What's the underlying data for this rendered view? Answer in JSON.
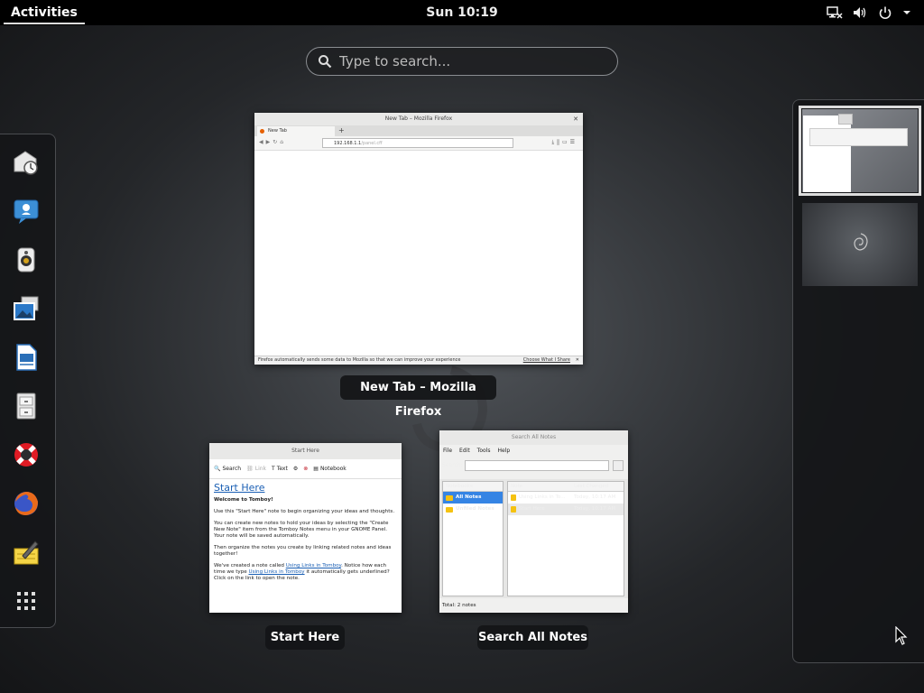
{
  "topbar": {
    "activities_label": "Activities",
    "clock": "Sun 10:19",
    "tray_icons": [
      "network-icon",
      "volume-icon",
      "power-icon",
      "chevron-down-icon"
    ]
  },
  "search": {
    "placeholder": "Type to search..."
  },
  "dash": {
    "items": [
      {
        "name": "evolution",
        "icon": "mail-clock-icon"
      },
      {
        "name": "empathy",
        "icon": "chat-bubble-icon"
      },
      {
        "name": "rhythmbox",
        "icon": "speaker-icon"
      },
      {
        "name": "shotwell",
        "icon": "photos-icon"
      },
      {
        "name": "libreoffice-writer",
        "icon": "document-icon"
      },
      {
        "name": "files",
        "icon": "file-cabinet-icon"
      },
      {
        "name": "help",
        "icon": "lifebuoy-icon"
      },
      {
        "name": "firefox",
        "icon": "firefox-icon"
      },
      {
        "name": "tomboy",
        "icon": "notes-pen-icon"
      },
      {
        "name": "show-applications",
        "icon": "app-grid-icon"
      }
    ]
  },
  "windows": {
    "firefox": {
      "caption": "New Tab – Mozilla Firefox",
      "title": "New Tab – Mozilla Firefox",
      "tab_label": "New Tab",
      "url_typed": "192.168.1.1",
      "url_suggest": "/panel.cff",
      "status_text": "Firefox automatically sends some data to Mozilla so that we can improve your experience",
      "status_link": "Choose What I Share"
    },
    "start_here": {
      "caption": "Start Here",
      "title": "Start Here",
      "toolbar": {
        "search": "Search",
        "link": "Link",
        "text": "Text",
        "notebook": "Notebook"
      },
      "heading": "Start Here",
      "welcome": "Welcome to Tomboy!",
      "p1": "Use this \"Start Here\" note to begin organizing your ideas and thoughts.",
      "p2": "You can create new notes to hold your ideas by selecting the \"Create New Note\" item from the Tomboy Notes menu in your GNOME Panel. Your note will be saved automatically.",
      "p3": "Then organize the notes you create by linking related notes and ideas together!",
      "p4_pre": "We've created a note called ",
      "p4_link1": "Using Links in Tomboy",
      "p4_mid": ". Notice how each time we type ",
      "p4_link2": "Using Links in Tomboy",
      "p4_post": " it automatically gets underlined? Click on the link to open the note."
    },
    "search_notes": {
      "caption": "Search All Notes",
      "title": "Search All Notes",
      "menu": [
        "File",
        "Edit",
        "Tools",
        "Help"
      ],
      "search_label": "Search:",
      "notebooks_header": "Notebooks",
      "notebooks": [
        "All Notes",
        "Unfiled Notes"
      ],
      "note_header": "Note",
      "changed_header": "Last Changed",
      "notes": [
        {
          "title": "Using Links in To...",
          "date": "Today, 10:17 AM"
        },
        {
          "title": "Start Here",
          "date": "Today, 10:17 AM"
        }
      ],
      "footer": "Total: 2 notes"
    }
  },
  "workspaces": {
    "count": 2,
    "active_index": 0
  }
}
